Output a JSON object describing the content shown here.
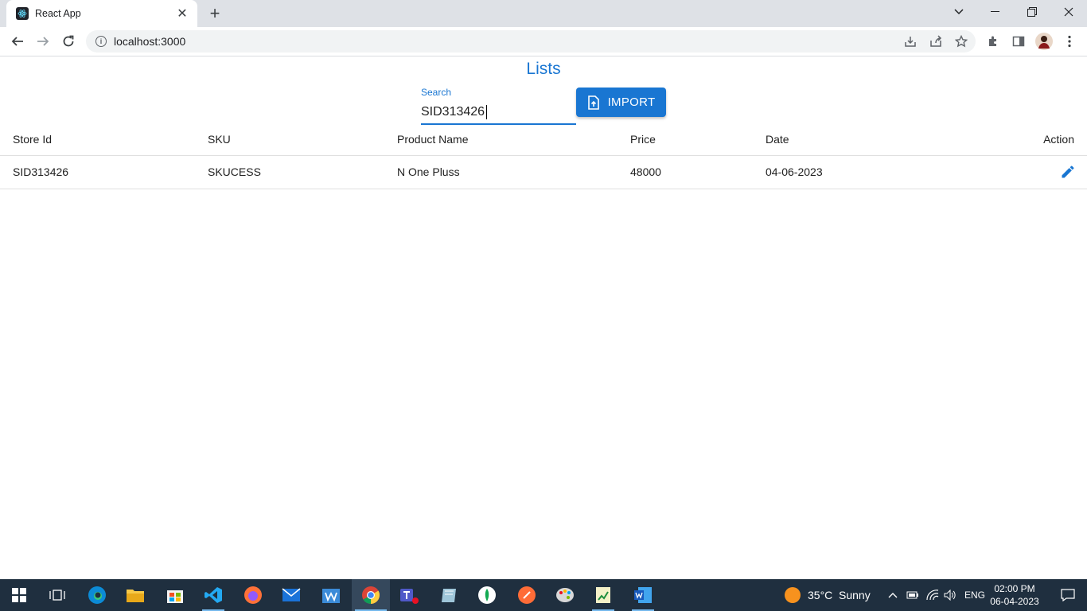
{
  "browser": {
    "tab_title": "React App",
    "new_tab_symbol": "+",
    "url": "localhost:3000"
  },
  "page": {
    "title": "Lists",
    "search": {
      "label": "Search",
      "value": "SID313426"
    },
    "import_label": "IMPORT",
    "table": {
      "headers": [
        "Store Id",
        "SKU",
        "Product Name",
        "Price",
        "Date",
        "Action"
      ],
      "rows": [
        {
          "store_id": "SID313426",
          "sku": "SKUCESS",
          "product_name": "N One Pluss",
          "price": "48000",
          "date": "04-06-2023"
        }
      ]
    }
  },
  "taskbar": {
    "weather": {
      "temp": "35°C",
      "condition": "Sunny"
    },
    "language": "ENG",
    "time": "02:00 PM",
    "date": "06-04-2023"
  },
  "colors": {
    "accent": "#1976d2",
    "tabbar": "#dee1e6",
    "taskbar": "#1f2f3f"
  }
}
